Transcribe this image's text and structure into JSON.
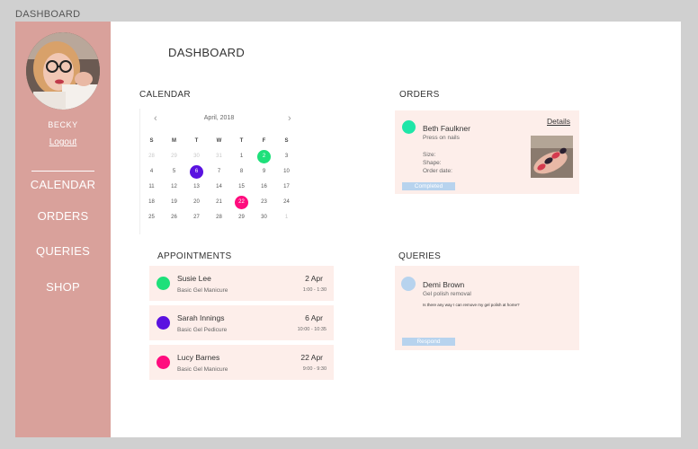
{
  "frame_title": "DASHBOARD",
  "sidebar": {
    "user_name": "BECKY",
    "logout_label": "Logout",
    "nav": [
      "CALENDAR",
      "ORDERS",
      "QUERIES",
      "SHOP"
    ]
  },
  "main": {
    "title": "DASHBOARD",
    "calendar": {
      "section_title": "CALENDAR",
      "prev_icon": "‹",
      "next_icon": "›",
      "month_label": "April, 2018",
      "weekdays": [
        "S",
        "M",
        "T",
        "W",
        "T",
        "F",
        "S"
      ],
      "weeks": [
        [
          {
            "d": "28",
            "o": true
          },
          {
            "d": "29",
            "o": true
          },
          {
            "d": "30",
            "o": true
          },
          {
            "d": "31",
            "o": true
          },
          {
            "d": "1"
          },
          {
            "d": "2",
            "m": "#1ee07a"
          },
          {
            "d": "3"
          }
        ],
        [
          {
            "d": "4"
          },
          {
            "d": "5"
          },
          {
            "d": "6",
            "m": "#5a12e0"
          },
          {
            "d": "7"
          },
          {
            "d": "8"
          },
          {
            "d": "9"
          },
          {
            "d": "10"
          }
        ],
        [
          {
            "d": "11"
          },
          {
            "d": "12"
          },
          {
            "d": "13"
          },
          {
            "d": "14"
          },
          {
            "d": "15"
          },
          {
            "d": "16"
          },
          {
            "d": "17"
          }
        ],
        [
          {
            "d": "18"
          },
          {
            "d": "19"
          },
          {
            "d": "20"
          },
          {
            "d": "21"
          },
          {
            "d": "22",
            "m": "#ff0c7e"
          },
          {
            "d": "23"
          },
          {
            "d": "24"
          }
        ],
        [
          {
            "d": "25"
          },
          {
            "d": "26"
          },
          {
            "d": "27"
          },
          {
            "d": "28"
          },
          {
            "d": "29"
          },
          {
            "d": "30"
          },
          {
            "d": "1",
            "o": true
          }
        ]
      ]
    },
    "appointments": {
      "section_title": "APPOINTMENTS",
      "items": [
        {
          "name": "Susie Lee",
          "service": "Basic Gel Manicure",
          "date": "2 Apr",
          "time": "1:00 - 1:30",
          "color": "#1ee07a"
        },
        {
          "name": "Sarah Innings",
          "service": "Basic Gel Pedicure",
          "date": "6 Apr",
          "time": "10:00 - 10:35",
          "color": "#5a12e0"
        },
        {
          "name": "Lucy Barnes",
          "service": "Basic Gel Manicure",
          "date": "22 Apr",
          "time": "9:00 - 9:30",
          "color": "#ff0c7e"
        }
      ]
    },
    "orders": {
      "section_title": "ORDERS",
      "name": "Beth Faulkner",
      "product": "Press on nails",
      "size_label": "Size:",
      "shape_label": "Shape:",
      "order_date_label": "Order date:",
      "details_label": "Details",
      "status": "Completed",
      "dot_color": "#1ee6a8"
    },
    "queries": {
      "section_title": "QUERIES",
      "name": "Demi Brown",
      "topic": "Gel polish removal",
      "message": "Is there any way I can remove my gel polish at home?",
      "respond_label": "Respond",
      "dot_color": "#b7d3ee"
    }
  }
}
